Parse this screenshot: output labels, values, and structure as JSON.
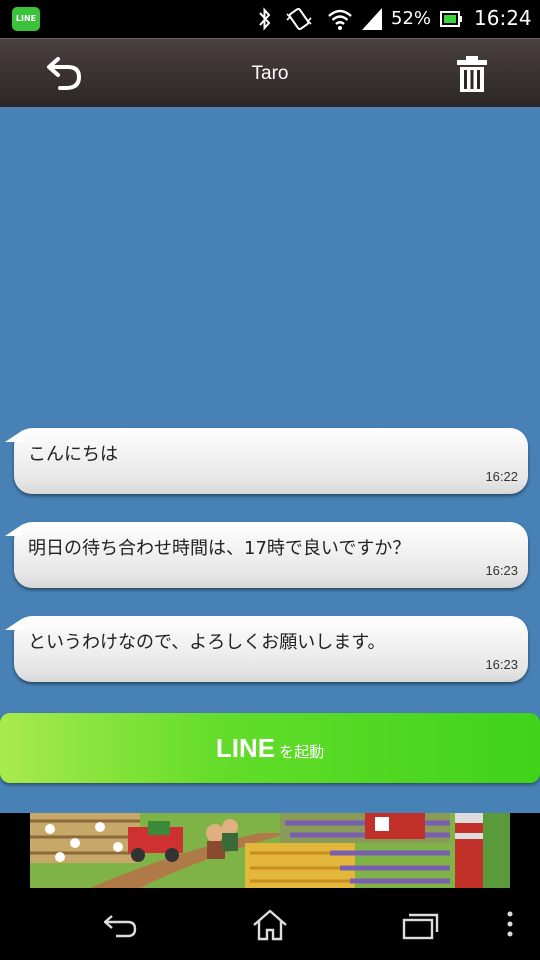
{
  "status_bar": {
    "notification_app": "LINE",
    "battery_percent": "52%",
    "clock": "16:24",
    "icons": [
      "line-icon",
      "bluetooth-icon",
      "vibrate-icon",
      "wifi-icon",
      "signal-icon",
      "battery-icon"
    ]
  },
  "header": {
    "title": "Taro",
    "back_icon": "back-arrow-icon",
    "trash_icon": "trash-icon"
  },
  "colors": {
    "chat_background": "#4781b5",
    "header": "#2c2626",
    "launch_button": "#3fd31a"
  },
  "messages": [
    {
      "text": "こんにちは",
      "time": "16:22"
    },
    {
      "text": "明日の待ち合わせ時間は、17時で良いですか？",
      "time": "16:23"
    },
    {
      "text": "というわけなので、よろしくお願いします。",
      "time": "16:23"
    }
  ],
  "launch_button": {
    "brand": "LINE",
    "suffix": "を起動"
  },
  "nav_bar": {
    "icons": [
      "back-icon",
      "home-icon",
      "recent-apps-icon",
      "menu-icon"
    ]
  }
}
